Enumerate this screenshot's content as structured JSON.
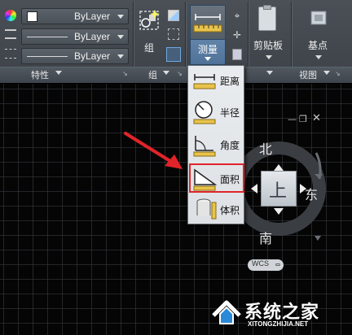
{
  "ribbon": {
    "properties": {
      "color_value": "ByLayer",
      "linetype_value": "ByLayer",
      "lineweight_value": "ByLayer",
      "panel_label": "特性"
    },
    "group": {
      "button_label": "组",
      "panel_label": "组"
    },
    "utilities": {
      "measure_label": "测量"
    },
    "clipboard": {
      "button_label": "剪贴板"
    },
    "view": {
      "basepoint_label": "基点",
      "panel_label": "视图"
    }
  },
  "measure_menu": {
    "items": [
      {
        "label": "距离",
        "icon": "distance-icon"
      },
      {
        "label": "半径",
        "icon": "radius-icon"
      },
      {
        "label": "角度",
        "icon": "angle-icon"
      },
      {
        "label": "面积",
        "icon": "area-icon",
        "highlighted": true
      },
      {
        "label": "体积",
        "icon": "volume-icon"
      }
    ]
  },
  "navcube": {
    "north": "北",
    "south": "南",
    "east": "东",
    "face": "上",
    "ucs": "WCS"
  },
  "watermark": {
    "title": "系统之家",
    "url": "XITONGZHIJIA.NET"
  },
  "colors": {
    "highlight": "#e0242a",
    "arrow": "#e0242a",
    "ribbon": "#40464c",
    "canvas": "#050505"
  }
}
